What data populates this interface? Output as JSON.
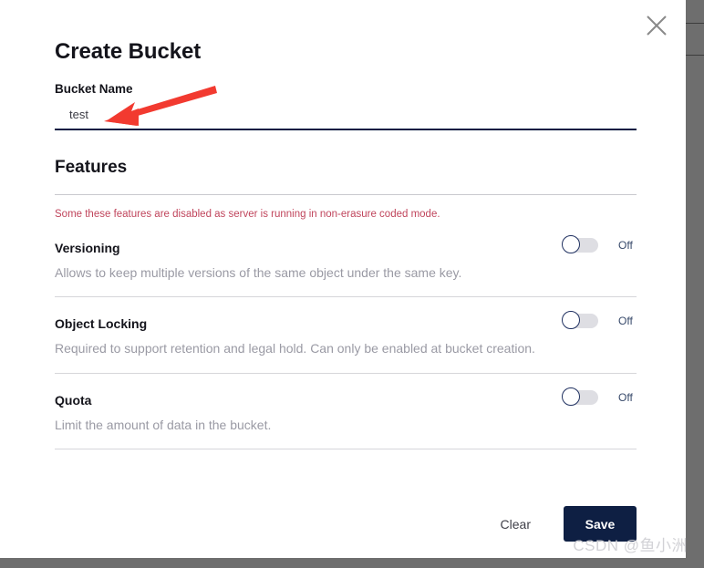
{
  "modal": {
    "title": "Create Bucket",
    "close_icon": "close-icon"
  },
  "bucket_name_field": {
    "label": "Bucket Name",
    "value": "test",
    "placeholder": ""
  },
  "features_section": {
    "title": "Features",
    "warning": "Some these features are disabled as server is running in non-erasure coded mode.",
    "warning_color": "#c0455c",
    "rows": [
      {
        "name": "Versioning",
        "description": "Allows to keep multiple versions of the same object under the same key.",
        "toggle_state": "Off"
      },
      {
        "name": "Object Locking",
        "description": "Required to support retention and legal hold. Can only be enabled at bucket creation.",
        "toggle_state": "Off"
      },
      {
        "name": "Quota",
        "description": "Limit the amount of data in the bucket.",
        "toggle_state": "Off"
      }
    ]
  },
  "footer": {
    "clear_label": "Clear",
    "save_label": "Save",
    "save_bg": "#0e1f43"
  },
  "annotation": {
    "arrow_color": "#f23a30"
  },
  "watermark": {
    "text": "CSDN @鱼小洲"
  }
}
